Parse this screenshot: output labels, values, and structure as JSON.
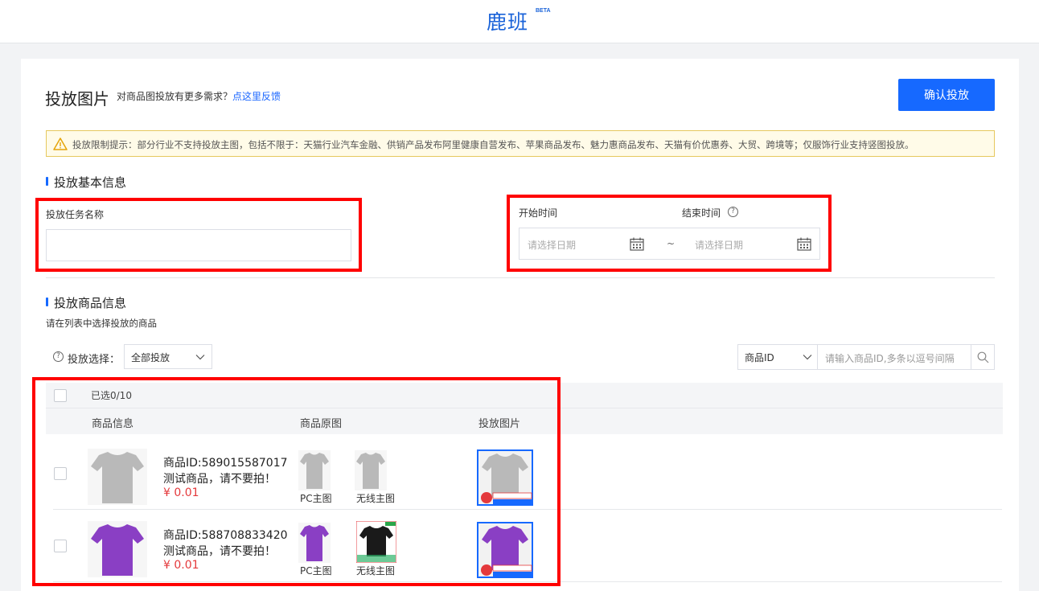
{
  "header": {
    "logo": "鹿班",
    "badge": "BETA"
  },
  "page": {
    "title": "投放图片",
    "subtitle_text": "对商品图投放有更多需求？",
    "feedback_link": "点这里反馈",
    "confirm_button": "确认投放"
  },
  "notice": {
    "text": "投放限制提示：部分行业不支持投放主图，包括不限于：天猫行业汽车金融、供销产品发布阿里健康自营发布、苹果商品发布、魅力惠商品发布、天猫有价优惠券、大贸、跨境等；仅服饰行业支持竖图投放。",
    "icon": "warning-icon"
  },
  "basic_info": {
    "section_title": "投放基本信息",
    "task_name_label": "投放任务名称",
    "task_name_value": "",
    "start_label": "开始时间",
    "end_label": "结束时间",
    "start_placeholder": "请选择日期",
    "end_placeholder": "请选择日期",
    "range_sep": "~",
    "help_glyph": "?"
  },
  "products": {
    "section_title": "投放商品信息",
    "hint": "请在列表中选择投放的商品",
    "filter_label": "投放选择：",
    "filter_value": "全部投放",
    "search_type": "商品ID",
    "search_placeholder": "请输入商品ID,多条以逗号间隔",
    "selected_count": "已选0/10",
    "columns": [
      "商品信息",
      "商品原图",
      "投放图片"
    ],
    "rows": [
      {
        "id": "商品ID:589015587017",
        "name": "测试商品，请不要拍！",
        "price": "¥ 0.01",
        "shirt_color": "#b9b9b9",
        "pc_caption": "PC主图",
        "mobile_caption": "无线主图"
      },
      {
        "id": "商品ID:588708833420",
        "name": "测试商品，请不要拍！",
        "price": "¥ 0.01",
        "shirt_color": "#8a3fc4",
        "pc_caption": "PC主图",
        "mobile_caption": "无线主图"
      }
    ]
  },
  "colors": {
    "accent": "#1669ff",
    "highlight": "#ff0000",
    "price": "#e4393c"
  }
}
